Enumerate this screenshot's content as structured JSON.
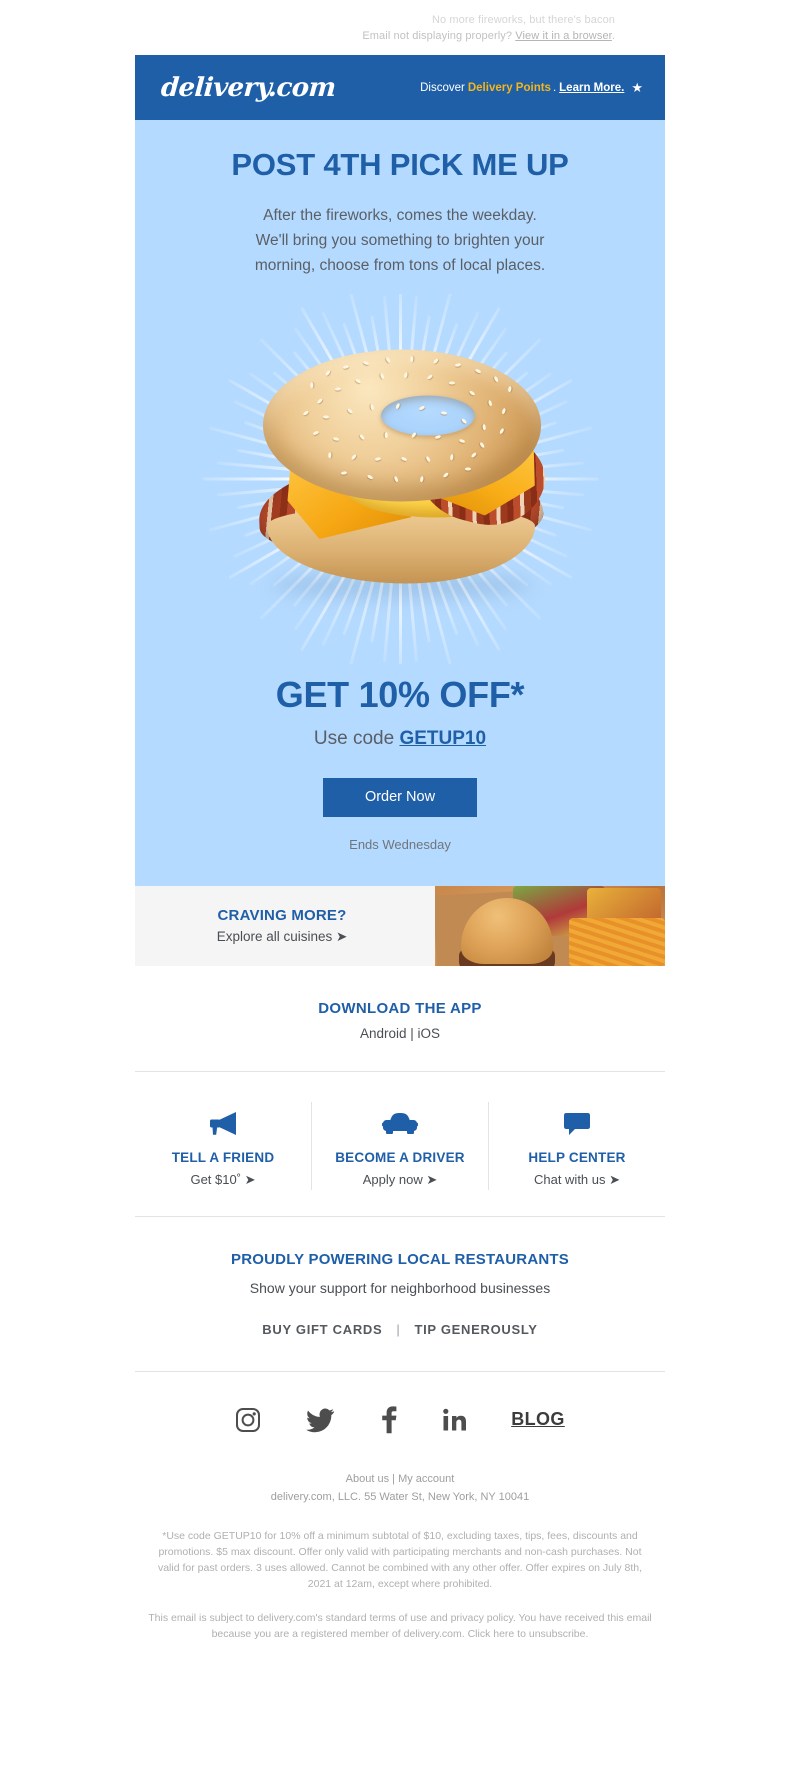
{
  "preheader": {
    "teaser": "No more fireworks, but there's bacon",
    "not_displaying": "Email not displaying properly?",
    "view_in_browser": "View it in a browser",
    "period": "."
  },
  "masthead": {
    "logo": "delivery.com",
    "discover": "Discover",
    "delivery_points": "Delivery Points",
    "dot": ".",
    "learn_more": "Learn More.",
    "star": "★"
  },
  "hero": {
    "headline": "POST 4TH PICK ME UP",
    "sub_line1": "After the fireworks, comes the weekday.",
    "sub_line2": "We'll bring you something to brighten your",
    "sub_line3": "morning, choose from tons of local places."
  },
  "offer": {
    "headline": "GET 10% OFF*",
    "use_code_prefix": "Use code ",
    "promo_code": "GETUP10",
    "cta_label": "Order Now",
    "ends": "Ends Wednesday"
  },
  "craving": {
    "title": "CRAVING MORE?",
    "subtitle": "Explore all cuisines ➤"
  },
  "download": {
    "title": "DOWNLOAD THE APP",
    "android": "Android",
    "separator": " | ",
    "ios": "iOS"
  },
  "columns": [
    {
      "icon": "megaphone-icon",
      "title": "TELL A FRIEND",
      "subtitle": "Get $10˚ ➤"
    },
    {
      "icon": "car-icon",
      "title": "BECOME A DRIVER",
      "subtitle": "Apply now ➤"
    },
    {
      "icon": "chat-bubble-icon",
      "title": "HELP CENTER",
      "subtitle": "Chat with us ➤"
    }
  ],
  "powering": {
    "title": "PROUDLY POWERING LOCAL RESTAURANTS",
    "subtitle": "Show your support for neighborhood businesses",
    "gift_cards": "BUY GIFT CARDS",
    "separator": "|",
    "tip": "TIP GENEROUSLY"
  },
  "social": {
    "instagram": "instagram-icon",
    "twitter": "twitter-icon",
    "facebook": "facebook-icon",
    "linkedin": "linkedin-icon",
    "blog_label": "BLOG"
  },
  "footer": {
    "about_us": "About us",
    "pipe": " | ",
    "my_account": "My account",
    "address": "delivery.com, LLC. 55 Water St, New York, NY 10041",
    "fine_print": "*Use code GETUP10 for 10% off a minimum subtotal of $10, excluding taxes, tips, fees, discounts and promotions. $5 max discount. Offer only valid with participating merchants and non-cash purchases. Not valid for past orders. 3 uses allowed. Cannot be combined with any other offer. Offer expires on July 8th, 2021 at 12am, except where prohibited.",
    "legal": "This email is subject to delivery.com's standard terms of use and privacy policy. You have received this email because you are a registered member of delivery.com. Click here to unsubscribe."
  },
  "colors": {
    "brand_blue": "#1f5fa8",
    "hero_bg": "#b5daff",
    "accent_gold": "#f2b51d",
    "band_gray": "#f5f5f5"
  }
}
